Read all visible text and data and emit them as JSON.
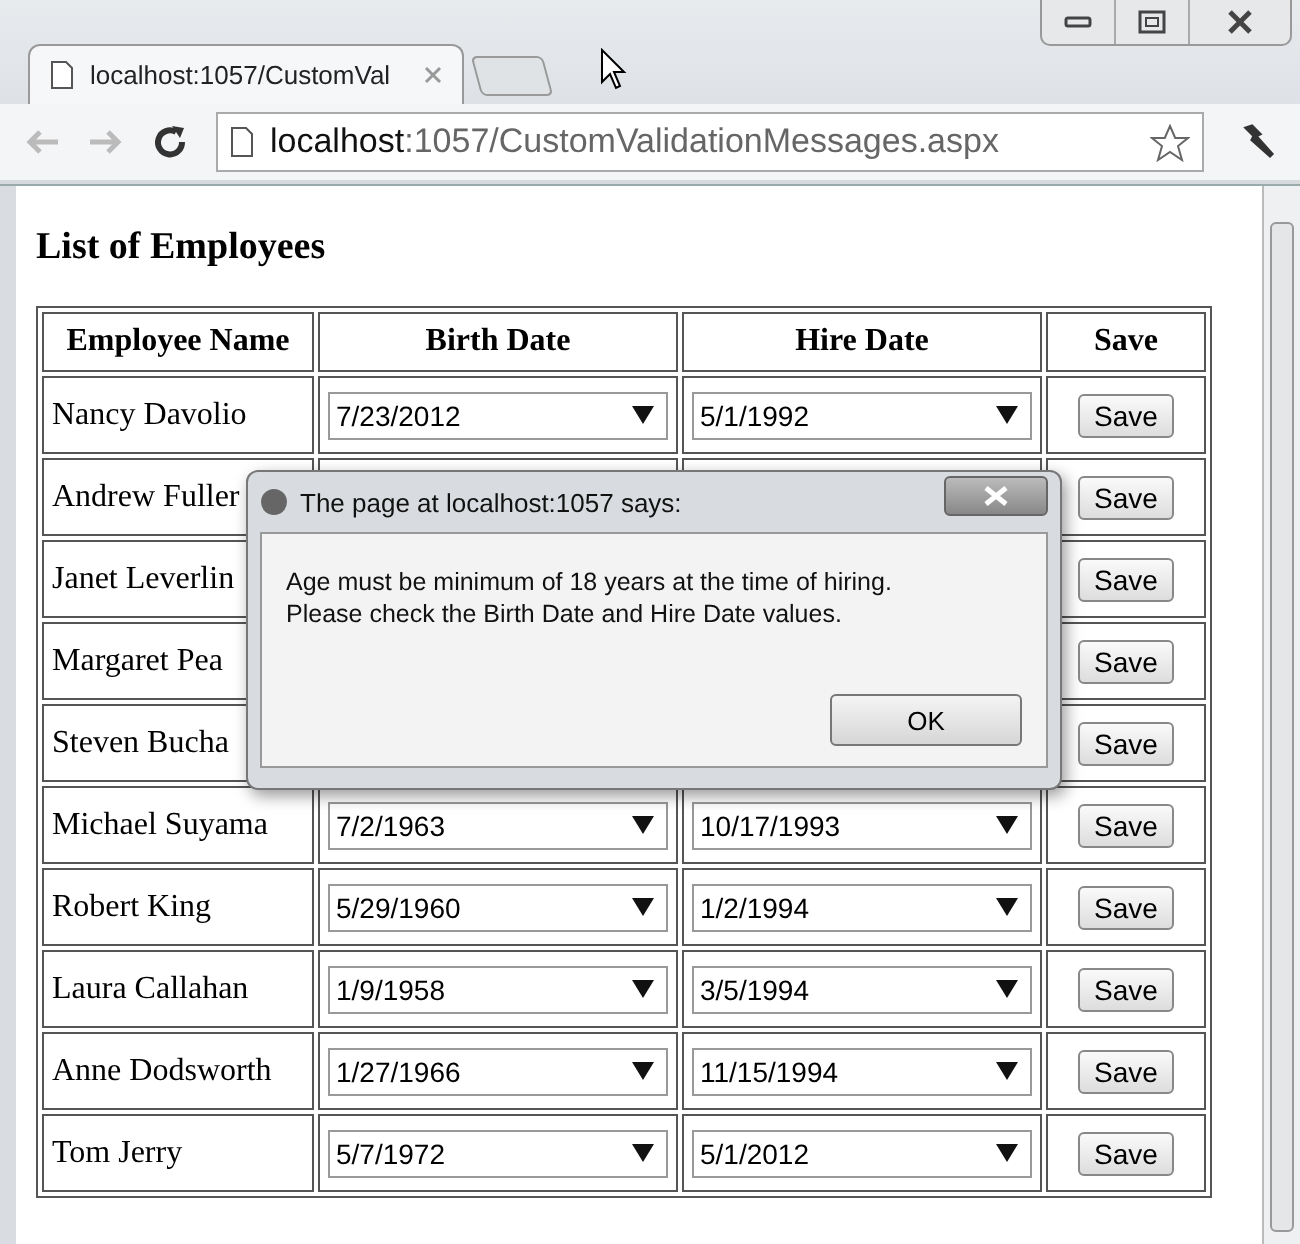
{
  "browser": {
    "tab_title": "localhost:1057/CustomVal",
    "address_host": "localhost",
    "address_rest": ":1057/CustomValidationMessages.aspx"
  },
  "page": {
    "heading": "List of Employees",
    "columns": [
      "Employee Name",
      "Birth Date",
      "Hire Date",
      "Save"
    ],
    "rows": [
      {
        "name": "Nancy Davolio",
        "birth_date": "7/23/2012",
        "hire_date": "5/1/1992",
        "save": "Save"
      },
      {
        "name": "Andrew Fuller",
        "save": "Save"
      },
      {
        "name": "Janet Leverlin",
        "save": "Save"
      },
      {
        "name": "Margaret Pea",
        "save": "Save"
      },
      {
        "name": "Steven Bucha",
        "save": "Save"
      },
      {
        "name": "Michael Suyama",
        "birth_date": "7/2/1963",
        "hire_date": "10/17/1993",
        "save": "Save"
      },
      {
        "name": "Robert King",
        "birth_date": "5/29/1960",
        "hire_date": "1/2/1994",
        "save": "Save"
      },
      {
        "name": "Laura Callahan",
        "birth_date": "1/9/1958",
        "hire_date": "3/5/1994",
        "save": "Save"
      },
      {
        "name": "Anne Dodsworth",
        "birth_date": "1/27/1966",
        "hire_date": "11/15/1994",
        "save": "Save"
      },
      {
        "name": "Tom Jerry",
        "birth_date": "5/7/1972",
        "hire_date": "5/1/2012",
        "save": "Save"
      }
    ]
  },
  "dialog": {
    "title": "The page at localhost:1057 says:",
    "message_lines": [
      "Age must be minimum of 18 years at the time of hiring.",
      "Please check the Birth Date and Hire Date values."
    ],
    "ok": "OK"
  }
}
